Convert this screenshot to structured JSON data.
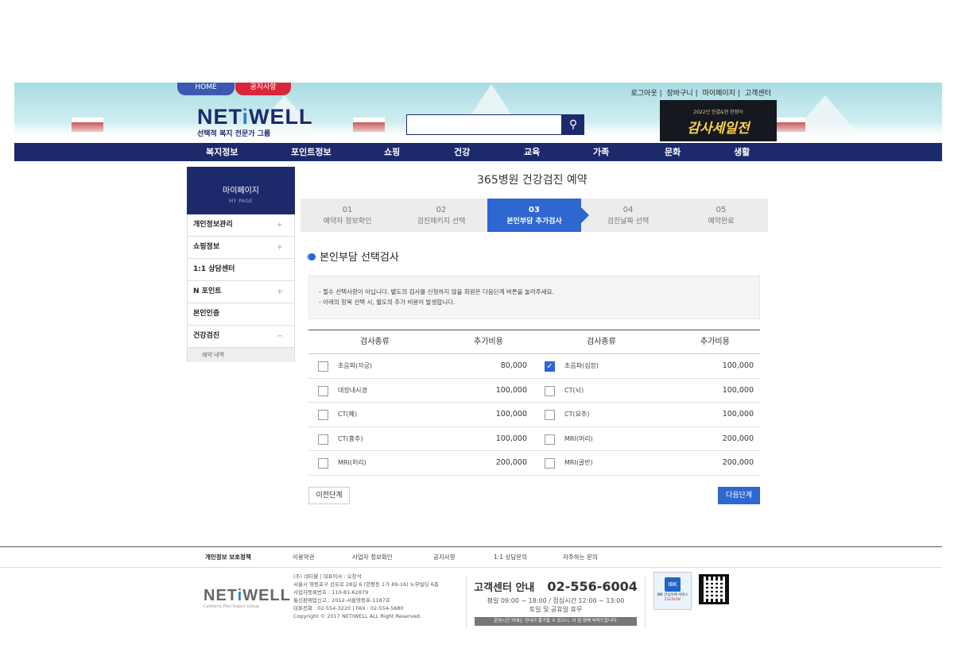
{
  "header": {
    "home": "HOME",
    "notice": "공지사항",
    "logo": {
      "brand_a": "NET",
      "brand_i": "i",
      "brand_b": "WELL",
      "tagline": "선택적 복지 전문가 그룹"
    },
    "search_placeholder": "",
    "search_icon": "search-icon",
    "toplinks": [
      "로그아웃",
      "장바구니",
      "마이페이지",
      "고객센터"
    ],
    "banner": {
      "small": "2022년 한결&현 한정아",
      "big": "감사세일전"
    }
  },
  "nav": [
    "복지정보",
    "포인트정보",
    "쇼핑",
    "건강",
    "교육",
    "가족",
    "문화",
    "생활"
  ],
  "sidebar": {
    "title": "마이페이지",
    "subtitle": "MY PAGE",
    "items": [
      {
        "label": "개인정보관리",
        "mark": "+"
      },
      {
        "label": "쇼핑정보",
        "mark": "+"
      },
      {
        "label": "1:1 상담센터",
        "mark": ""
      },
      {
        "label": "N 포인트",
        "mark": "+"
      },
      {
        "label": "본인인증",
        "mark": ""
      },
      {
        "label": "건강검진",
        "mark": "−"
      }
    ],
    "sub": "예약 내역"
  },
  "main": {
    "title": "365병원 건강검진 예약",
    "steps": [
      {
        "num": "01",
        "label": "예약자 정보확인"
      },
      {
        "num": "02",
        "label": "검진패키지 선택"
      },
      {
        "num": "03",
        "label": "본인부담 추가검사"
      },
      {
        "num": "04",
        "label": "검진날짜 선택"
      },
      {
        "num": "05",
        "label": "예약완료"
      }
    ],
    "active_step": 3,
    "section_title": "본인부담 선택검사",
    "notice": [
      "- 필수 선택사항이 아닙니다. 별도의 검사를 신청하지 않을 회원은 다음단계 버튼을 눌러주세요.",
      "- 아래의 항목 선택 시, 별도의 추가 비용이 발생합니다."
    ],
    "table": {
      "headers": [
        "검사종류",
        "추가비용",
        "검사종류",
        "추가비용"
      ],
      "rows": [
        [
          {
            "name": "초음파(자궁)",
            "price": "80,000",
            "checked": false
          },
          {
            "name": "초음파(심장)",
            "price": "100,000",
            "checked": true
          }
        ],
        [
          {
            "name": "대장내시경",
            "price": "100,000",
            "checked": false
          },
          {
            "name": "CT(뇌)",
            "price": "100,000",
            "checked": false
          }
        ],
        [
          {
            "name": "CT(폐)",
            "price": "100,000",
            "checked": false
          },
          {
            "name": "CT(요추)",
            "price": "100,000",
            "checked": false
          }
        ],
        [
          {
            "name": "CT(흉추)",
            "price": "100,000",
            "checked": false
          },
          {
            "name": "MRI(머리)",
            "price": "200,000",
            "checked": false
          }
        ],
        [
          {
            "name": "MRI(허리)",
            "price": "200,000",
            "checked": false
          },
          {
            "name": "MRI(골반)",
            "price": "200,000",
            "checked": false
          }
        ]
      ]
    },
    "prev_button": "이전단계",
    "next_button": "다음단계",
    "accent": "#2d67cf"
  },
  "footer": {
    "links": [
      "개인정보 보호정책",
      "이용약관",
      "사업자 정보확인",
      "공지사항",
      "1:1 상담문의",
      "자주하는 문의"
    ],
    "logo": {
      "brand_a": "NET",
      "brand_i": "i",
      "brand_b": "WELL",
      "tagline": "Cafeteria Plan Expert Group"
    },
    "info": [
      "(주) 네티웰 | 대표이사 : 오창석",
      "서울시 영등포구 선유로 28길 6 (양평동 1가 89-16) 노무빌딩 6층",
      "사업자등록번호 : 110-81-62879",
      "통신판매업신고 : 2012-서울영등포-1187호",
      "대표전화 : 02-554-3220 | FAX : 02-554-5680",
      "Copyright © 2017 NETIWELL ALL Right Reserved."
    ],
    "cs": {
      "title": "고객센터 안내",
      "phone": "02-556-6004",
      "hours1": "평일 09:00 ~ 18:00 / 점심시간 12:00 ~ 13:00",
      "hours2": "토일 및 공휴일 휴무",
      "bar": "운영시간 외에는 안내가 불가할 수 있으니, 이 점 양해 부탁드립니다."
    },
    "escrow": {
      "mark": "IBK",
      "text1": "IBK 안심이체 서비스",
      "text2": "ESCROW"
    }
  }
}
